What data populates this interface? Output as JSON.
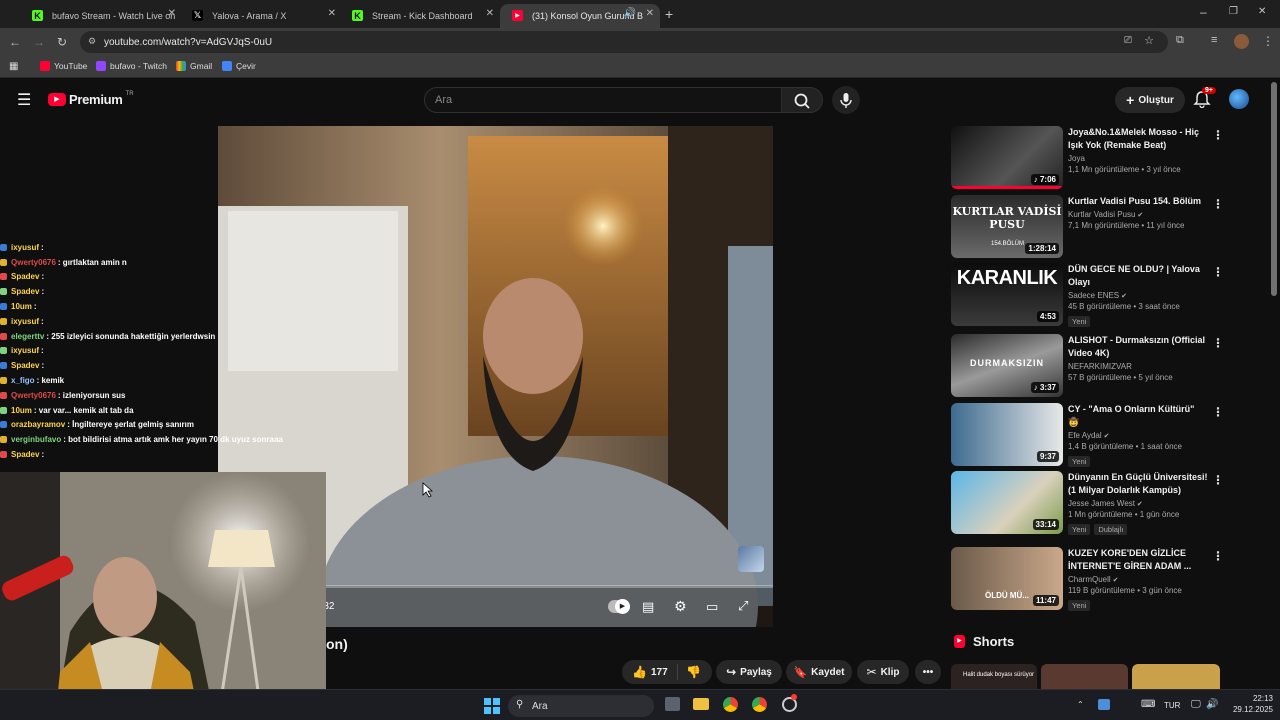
{
  "browser": {
    "tabs": [
      {
        "label": "bufavo Stream - Watch Live on",
        "icon": "kick-icon",
        "active": false
      },
      {
        "label": "Yalova - Arama / X",
        "icon": "x-icon",
        "active": false
      },
      {
        "label": "Stream - Kick Dashboard",
        "icon": "kick-icon",
        "active": false
      },
      {
        "label": "(31) Konsol Oyun Gururlu B",
        "icon": "youtube-icon",
        "active": true
      }
    ],
    "url": "youtube.com/watch?v=AdGVJqS-0uU",
    "bookmarks": [
      "YouTube",
      "bufavo - Twitch",
      "Gmail",
      "Çevir"
    ]
  },
  "youtube": {
    "logo_text": "Premium",
    "logo_badge": "TR",
    "search_placeholder": "Ara",
    "create_label": "Oluştur",
    "notification_count": "9+"
  },
  "player": {
    "time": "2:32",
    "title_fragment": "on)"
  },
  "actions": {
    "like_count": "177",
    "share_label": "Paylaş",
    "save_label": "Kaydet",
    "clip_label": "Klip"
  },
  "chat": {
    "messages": [
      {
        "user": "ixyusuf",
        "text": ":",
        "color": "#ffd54a"
      },
      {
        "user": "Qwerty0676",
        "text": ": gırtlaktan amin n",
        "color": "#e04a4a"
      },
      {
        "user": "Spadev",
        "text": ":",
        "color": "#ffd54a"
      },
      {
        "user": "Spadev",
        "text": ":",
        "color": "#ffd54a"
      },
      {
        "user": "10um",
        "text": ":",
        "color": "#ffd54a"
      },
      {
        "user": "ixyusuf",
        "text": ":",
        "color": "#ffd54a"
      },
      {
        "user": "elegerttv",
        "text": ": 255 izleyici sonunda hakettiğin yerlerdwsin",
        "color": "#7fd37f"
      },
      {
        "user": "ixyusuf",
        "text": ":",
        "color": "#ffd54a"
      },
      {
        "user": "Spadev",
        "text": ":",
        "color": "#ffd54a"
      },
      {
        "user": "x_figo",
        "text": ": kemik",
        "color": "#8fc3ff"
      },
      {
        "user": "Qwerty0676",
        "text": ": izleniyorsun sus",
        "color": "#e04a4a"
      },
      {
        "user": "10um",
        "text": ": var var... kemik alt tab da",
        "color": "#ffd54a"
      },
      {
        "user": "orazbayramov",
        "text": ": İngiltereye şerlat gelmiş sanırım",
        "color": "#ffd54a"
      },
      {
        "user": "verginbufavo",
        "text": ": bot bildirisi atma artık amk her yayın 70 dk uyuz sonraaa",
        "color": "#7fd37f"
      },
      {
        "user": "Spadev",
        "text": ":",
        "color": "#ffd54a"
      }
    ]
  },
  "recommendations": [
    {
      "title": "Joya&No.1&Melek Mosso - Hiç Işık Yok (Remake Beat)",
      "channel": "Joya",
      "verified": false,
      "stats": "1,1 Mn görüntüleme • 3 yıl önce",
      "duration": "7:06",
      "music": true,
      "new": false,
      "badge2": ""
    },
    {
      "title": "Kurtlar Vadisi Pusu 154. Bölüm",
      "channel": "Kurtlar Vadisi Pusu",
      "verified": true,
      "stats": "7,1 Mn görüntüleme • 11 yıl önce",
      "duration": "1:28:14",
      "music": false,
      "new": false,
      "badge2": "",
      "thumb_text": "KURTLAR VADİSİ PUSU",
      "thumb_sub": "154.BÖLÜM"
    },
    {
      "title": "DÜN GECE NE OLDU? | Yalova Olayı",
      "channel": "Sadece ENES",
      "verified": true,
      "stats": "45 B görüntüleme • 3 saat önce",
      "duration": "4:53",
      "music": false,
      "new": true,
      "badge2": "",
      "thumb_text": "KARANLIK"
    },
    {
      "title": "ALISHOT - Durmaksızın (Official Video 4K)",
      "channel": "NEFARKIMIZVAR",
      "verified": false,
      "stats": "57 B görüntüleme • 5 yıl önce",
      "duration": "3:37",
      "music": true,
      "new": false,
      "badge2": "",
      "thumb_text": "DURMAKSIZIN"
    },
    {
      "title": "CY - \"Ama O Onların Kültürü\" 🤠",
      "channel": "Efe Aydal",
      "verified": true,
      "stats": "1,4 B görüntüleme • 1 saat önce",
      "duration": "9:37",
      "music": false,
      "new": true,
      "badge2": ""
    },
    {
      "title": "Dünyanın En Güçlü Üniversitesi! (1 Milyar Dolarlık Kampüs)",
      "channel": "Jesse James West",
      "verified": true,
      "stats": "1 Mn görüntüleme • 1 gün önce",
      "duration": "33:14",
      "music": false,
      "new": true,
      "badge2": "Dublajlı"
    },
    {
      "title": "KUZEY KORE'DEN GİZLİCE İNTERNET'E GİREN ADAM ...",
      "channel": "CharmQuell",
      "verified": true,
      "stats": "119 B görüntüleme • 3 gün önce",
      "duration": "11:47",
      "music": false,
      "new": true,
      "badge2": "",
      "thumb_text": "ÖLDÜ MÜ..."
    }
  ],
  "new_label": "Yeni",
  "shorts_label": "Shorts",
  "shorts_thumb_text": "Halit dudak boyası sürüyor",
  "taskbar": {
    "search_label": "Ara",
    "lang": "TUR",
    "time": "22:13",
    "date": "29.12.2025"
  },
  "colors": {
    "youtube_red": "#ff0033",
    "kick_green": "#53fc18",
    "accent_blue": "#3ea6ff"
  }
}
